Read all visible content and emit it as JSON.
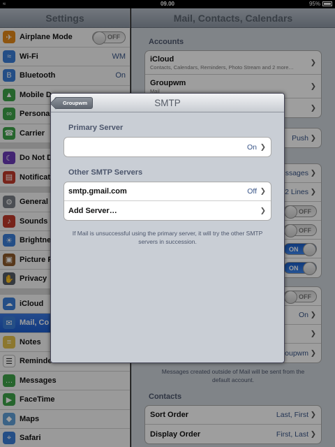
{
  "status_bar": {
    "time": "09.00",
    "battery": "95%"
  },
  "sidebar": {
    "title": "Settings",
    "groups": [
      [
        {
          "label": "Airplane Mode",
          "icon": "airplane-icon",
          "color": "#e68a19",
          "toggle": "OFF"
        },
        {
          "label": "Wi-Fi",
          "icon": "wifi-icon",
          "color": "#3a7ed8",
          "value": "WM"
        },
        {
          "label": "Bluetooth",
          "icon": "bluetooth-icon",
          "color": "#3a7ed8",
          "value": "On"
        },
        {
          "label": "Mobile D",
          "icon": "mobile-data-icon",
          "color": "#3ea44a"
        },
        {
          "label": "Persona",
          "icon": "personal-hotspot-icon",
          "color": "#3ea44a"
        },
        {
          "label": "Carrier",
          "icon": "phone-icon",
          "color": "#3ea44a"
        }
      ],
      [
        {
          "label": "Do Not D",
          "icon": "moon-icon",
          "color": "#6b3ab8"
        },
        {
          "label": "Notificat",
          "icon": "notifications-icon",
          "color": "#c0392b"
        }
      ],
      [
        {
          "label": "General",
          "icon": "gear-icon",
          "color": "#7a7f86"
        },
        {
          "label": "Sounds",
          "icon": "speaker-icon",
          "color": "#c0392b"
        },
        {
          "label": "Brightne",
          "icon": "brightness-icon",
          "color": "#3a7ed8"
        },
        {
          "label": "Picture F",
          "icon": "picture-frame-icon",
          "color": "#8d5a2b"
        },
        {
          "label": "Privacy",
          "icon": "hand-icon",
          "color": "#555c66"
        }
      ],
      [
        {
          "label": "iCloud",
          "icon": "cloud-icon",
          "color": "#3a7ed8"
        },
        {
          "label": "Mail, Co",
          "icon": "mail-icon",
          "color": "#3a7ed8",
          "selected": true
        },
        {
          "label": "Notes",
          "icon": "notes-icon",
          "color": "#e3c14b"
        },
        {
          "label": "Reminde",
          "icon": "reminders-icon",
          "color": "#ffffff"
        },
        {
          "label": "Messages",
          "icon": "messages-icon",
          "color": "#3ea44a"
        },
        {
          "label": "FaceTime",
          "icon": "facetime-icon",
          "color": "#3ea44a"
        },
        {
          "label": "Maps",
          "icon": "maps-icon",
          "color": "#5fa0d9"
        },
        {
          "label": "Safari",
          "icon": "compass-icon",
          "color": "#3a7ed8"
        }
      ]
    ]
  },
  "detail": {
    "title": "Mail, Contacts, Calendars",
    "accounts_header": "Accounts",
    "accounts": [
      {
        "title": "iCloud",
        "subtitle": "Contacts, Calendars, Reminders, Photo Stream and 2 more…"
      },
      {
        "title": "Groupwm",
        "subtitle": "Mail"
      }
    ],
    "fetch_value": "Push",
    "right_values": [
      "ssages",
      "2 Lines",
      "OFF",
      "OFF",
      "ON",
      "ON",
      "OFF",
      "On",
      "oupwm"
    ],
    "footer": "Messages created outside of Mail will be sent from the default account.",
    "contacts_header": "Contacts",
    "contacts_rows": [
      {
        "title": "Sort Order",
        "value": "Last, First"
      },
      {
        "title": "Display Order",
        "value": "First, Last"
      }
    ]
  },
  "modal": {
    "title": "SMTP",
    "back_label": "Groupwm",
    "primary_header": "Primary Server",
    "primary_value": "On",
    "other_header": "Other SMTP Servers",
    "other_rows": [
      {
        "title": "smtp.gmail.com",
        "value": "Off"
      },
      {
        "title": "Add Server…",
        "value": ""
      }
    ],
    "footer": "If Mail is unsuccessful using the primary server, it will try the other SMTP servers in succession."
  }
}
